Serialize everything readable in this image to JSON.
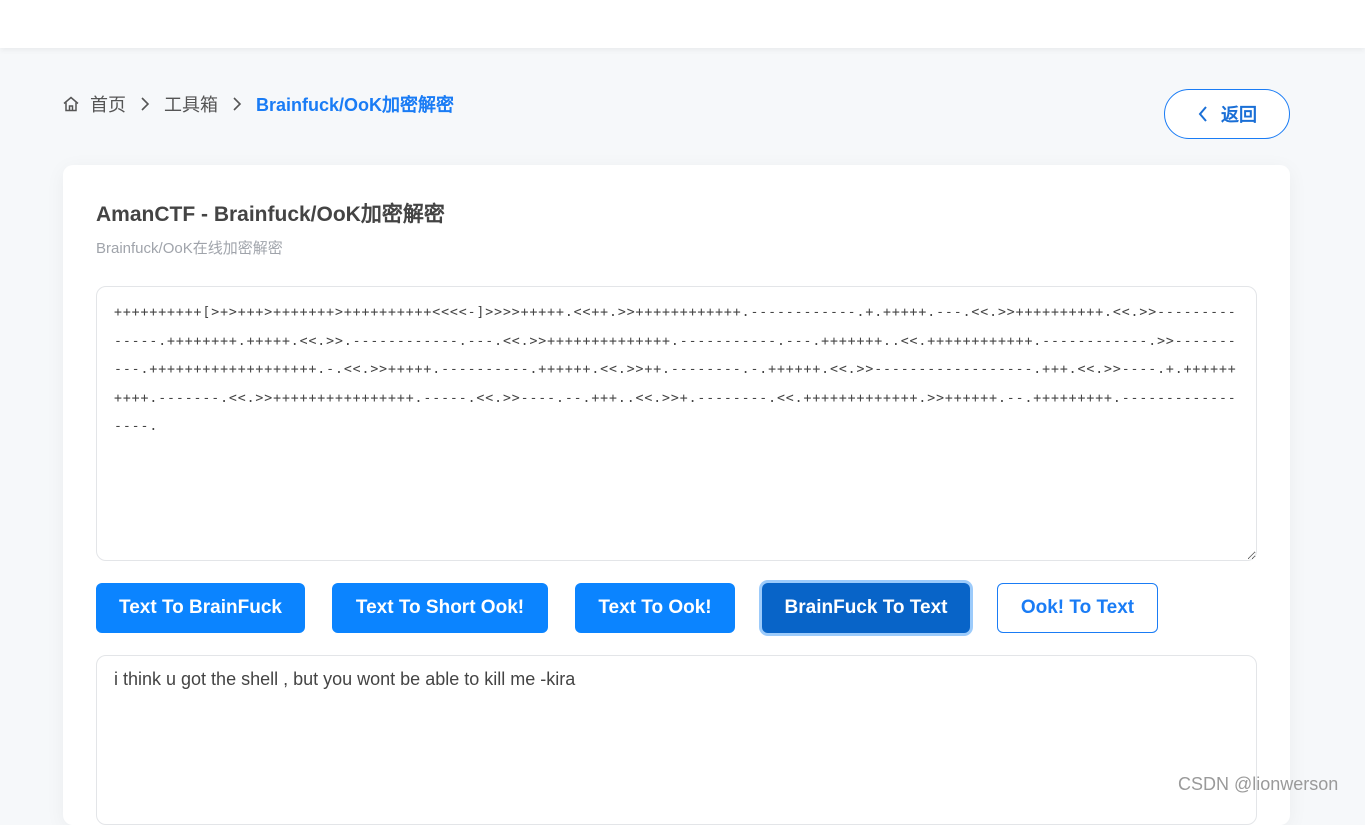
{
  "breadcrumb": {
    "home": "首页",
    "toolbox": "工具箱",
    "current": "Brainfuck/OoK加密解密"
  },
  "back_button": {
    "label": "返回"
  },
  "card": {
    "title": "AmanCTF - Brainfuck/OoK加密解密",
    "subtitle": "Brainfuck/OoK在线加密解密"
  },
  "input": {
    "value": "++++++++++[>+>+++>+++++++>++++++++++<<<<-]>>>>+++++.<<++.>>++++++++++++.------------.+.+++++.---.<<.>>++++++++++.<<.>>--------------.++++++++.+++++.<<.>>.------------.---.<<.>>++++++++++++++.-----------.---.+++++++..<<.++++++++++++.------------.>>----------.+++++++++++++++++++.-.<<.>>+++++.----------.++++++.<<.>>++.--------.-.++++++.<<.>>------------------.+++.<<.>>----.+.++++++++++.-------.<<.>>++++++++++++++++.-----.<<.>>----.--.+++..<<.>>+.--------.<<.+++++++++++++.>>++++++.--.+++++++++.-----------------."
  },
  "buttons": {
    "text_to_brainfuck": "Text To BrainFuck",
    "text_to_short_ook": "Text To Short Ook!",
    "text_to_ook": "Text To Ook!",
    "brainfuck_to_text": "BrainFuck To Text",
    "ook_to_text": "Ook! To Text"
  },
  "output": {
    "value": "i think u got the shell , but you wont be able to kill me -kira"
  },
  "watermark": "CSDN @lionwerson",
  "colors": {
    "accent": "#1a7cf5",
    "primary_button": "#0b84ff",
    "active_button": "#0864c8",
    "page_bg": "#f6f8fa"
  },
  "icons": {
    "home": "home-icon",
    "separator": "chevron-right-icon",
    "back": "chevron-left-icon"
  }
}
